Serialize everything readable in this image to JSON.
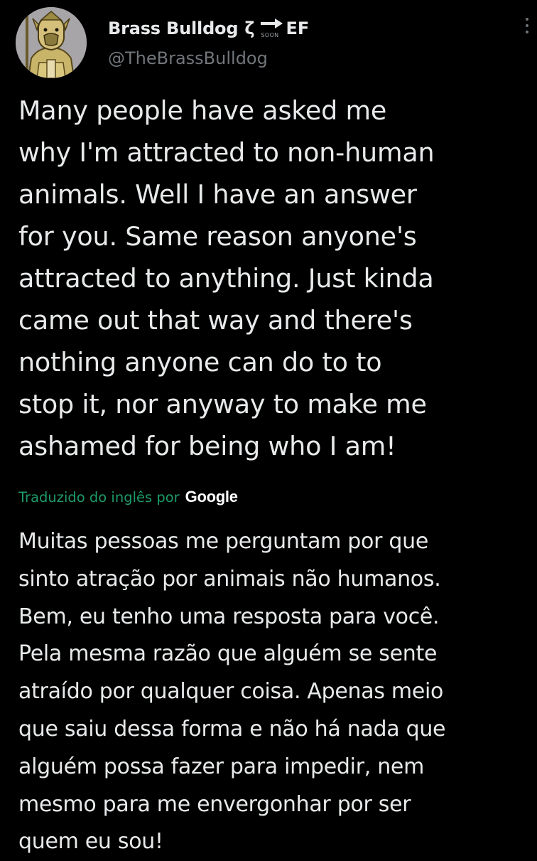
{
  "author": {
    "display_name": "Brass Bulldog",
    "name_glyph": "ζ",
    "badge_icon": "soon-arrow-icon",
    "badge_label": "SOON",
    "name_suffix": "EF",
    "handle": "@TheBrassBulldog",
    "avatar_icon": "brass-bulldog-armored-avatar"
  },
  "menu": {
    "icon": "more-vertical-icon"
  },
  "tweet": {
    "lines": [
      "Many people have asked me",
      "why I'm attracted to non-human",
      "animals. Well I have an answer",
      "for you. Same reason anyone's",
      "attracted to anything. Just kinda",
      "came out that way and there's",
      "nothing anyone can do to to",
      "stop it, nor anyway to make me",
      "ashamed for being who I am!"
    ]
  },
  "translation": {
    "attribution": "Traduzido do inglês por",
    "provider": "Google",
    "lines": [
      "Muitas pessoas me perguntam por que",
      "sinto atração por animais não humanos.",
      "Bem, eu tenho uma resposta para você.",
      "Pela mesma razão que alguém se sente",
      "atraído por qualquer coisa. Apenas meio",
      "que saiu dessa forma e não há nada que",
      "alguém possa fazer para impedir, nem",
      "mesmo para me envergonhar por ser",
      "quem eu sou!"
    ]
  },
  "colors": {
    "background": "#000000",
    "text_primary": "#e7e9ea",
    "text_secondary": "#71767b",
    "attribution_green": "#1d9b68"
  }
}
